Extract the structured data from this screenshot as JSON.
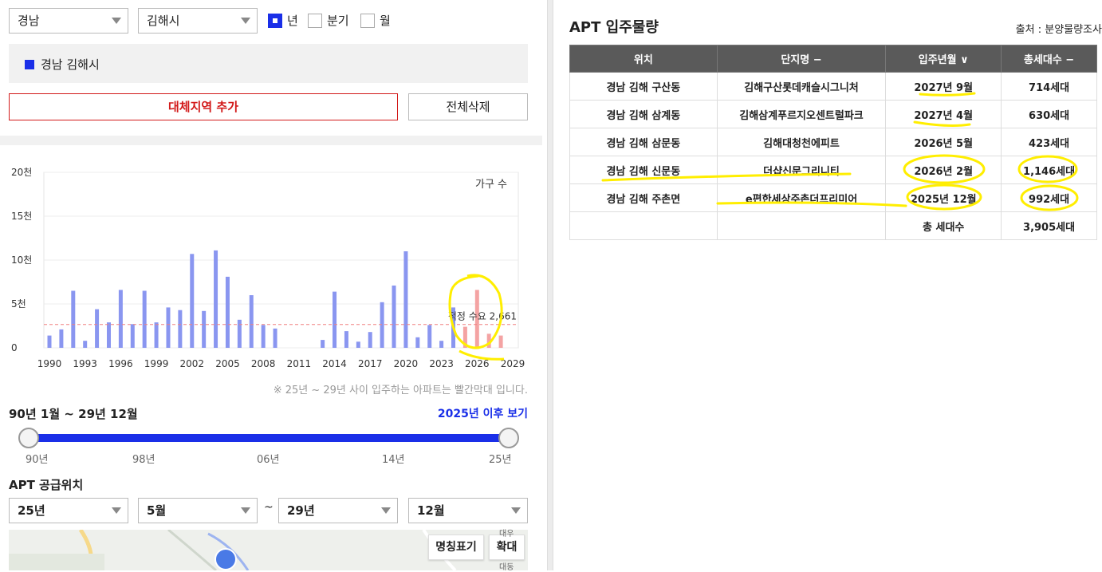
{
  "filters": {
    "province": "경남",
    "city": "김해시",
    "period_options": [
      {
        "label": "년",
        "checked": true
      },
      {
        "label": "분기",
        "checked": false
      },
      {
        "label": "월",
        "checked": false
      }
    ]
  },
  "selected_region": "경남 김해시",
  "buttons": {
    "add_region": "대체지역 추가",
    "delete_all": "전체삭제"
  },
  "chart_data": {
    "type": "bar",
    "legend_label": "가구 수",
    "y_ticks": [
      "20천",
      "15천",
      "10천",
      "5천",
      "0"
    ],
    "ylim": [
      0,
      20000
    ],
    "x_ticks": [
      "1990",
      "1993",
      "1996",
      "1999",
      "2002",
      "2005",
      "2008",
      "2011",
      "2014",
      "2017",
      "2020",
      "2023",
      "2026",
      "2029"
    ],
    "years": [
      1990,
      1991,
      1992,
      1993,
      1994,
      1995,
      1996,
      1997,
      1998,
      1999,
      2000,
      2001,
      2002,
      2003,
      2004,
      2005,
      2006,
      2007,
      2008,
      2009,
      2010,
      2011,
      2012,
      2013,
      2014,
      2015,
      2016,
      2017,
      2018,
      2019,
      2020,
      2021,
      2022,
      2023,
      2024,
      2025,
      2026,
      2027,
      2028,
      2029
    ],
    "values": [
      1400,
      2100,
      6500,
      800,
      4400,
      2900,
      6600,
      2700,
      6500,
      2900,
      4600,
      4300,
      10700,
      4200,
      11100,
      8100,
      3200,
      6000,
      2600,
      2200,
      0,
      0,
      0,
      900,
      6400,
      1900,
      700,
      1800,
      5200,
      7100,
      11000,
      1200,
      2600,
      800,
      4600,
      2400,
      6600,
      1600,
      1400,
      0
    ],
    "highlight_from_year": 2025,
    "bar_color": "#8a96f0",
    "highlight_color": "#f4a3a3",
    "demand_line": {
      "value": 2661,
      "label": "적정 수요 2,661"
    }
  },
  "chart_note": "※ 25년 ~ 29년 사이 입주하는 아파트는 빨간막대 입니다.",
  "range": {
    "title": "90년 1월 ~ 29년 12월",
    "link": "2025년 이후 보기",
    "ticks": [
      "90년",
      "98년",
      "06년",
      "14년",
      "25년"
    ]
  },
  "supply": {
    "title": "APT 공급위치",
    "from_year": "25년",
    "from_month": "5월",
    "tilde": "~",
    "to_year": "29년",
    "to_month": "12월"
  },
  "map": {
    "label_btn": "명칭표기",
    "zoom_btn": "확대",
    "place_mark": "대동",
    "place_mark2": "대우"
  },
  "apt": {
    "title": "APT 입주물량",
    "source": "출처 : 분양물량조사",
    "headers": [
      "위치",
      "단지명 −",
      "입주년월 ∨",
      "총세대수 −"
    ],
    "rows": [
      [
        "경남 김해 구산동",
        "김해구산롯데캐슬시그니처",
        "2027년 9월",
        "714세대"
      ],
      [
        "경남 김해 삼계동",
        "김해삼계푸르지오센트럴파크",
        "2027년 4월",
        "630세대"
      ],
      [
        "경남 김해 삼문동",
        "김해대청천에피트",
        "2026년 5월",
        "423세대"
      ],
      [
        "경남 김해 신문동",
        "더샵신문그리니티",
        "2026년 2월",
        "1,146세대"
      ],
      [
        "경남 김해 주촌면",
        "e편한세상주촌더프리미어",
        "2025년 12월",
        "992세대"
      ]
    ],
    "total_label": "총 세대수",
    "total_value": "3,905세대"
  }
}
